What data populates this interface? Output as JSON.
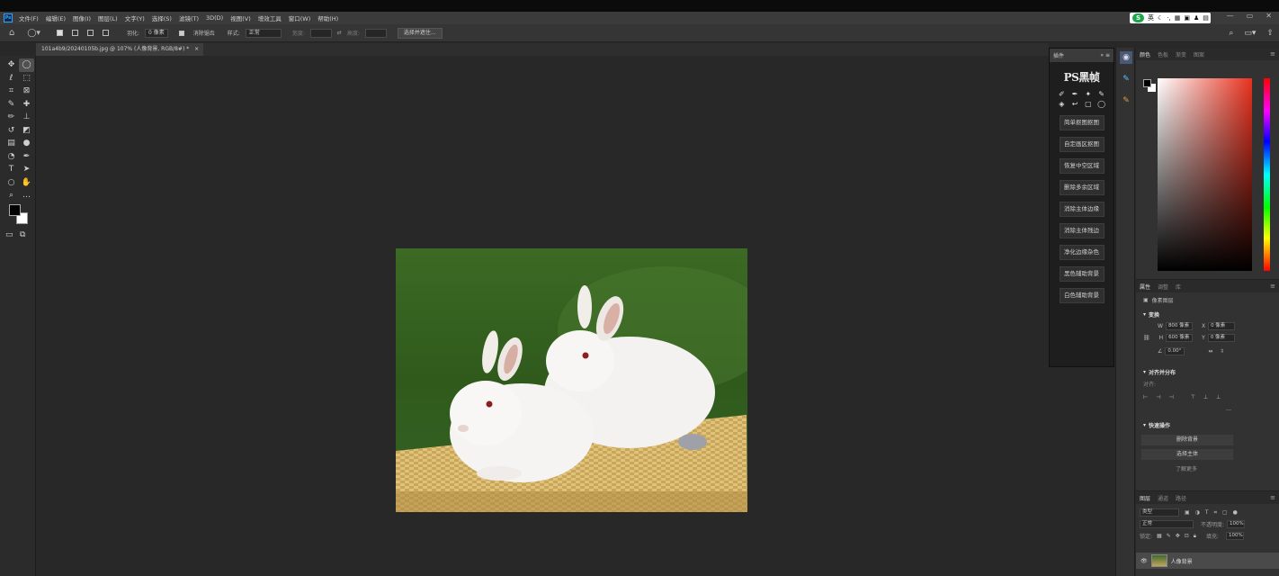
{
  "menu": {
    "logo": "Ps",
    "items": [
      "文件(F)",
      "编辑(E)",
      "图像(I)",
      "图层(L)",
      "文字(Y)",
      "选择(S)",
      "滤镜(T)",
      "3D(D)",
      "视图(V)",
      "增效工具",
      "窗口(W)",
      "帮助(H)"
    ]
  },
  "ime": {
    "brand": "S",
    "label": "英"
  },
  "window_controls": [
    "—",
    "▭",
    "✕"
  ],
  "options": {
    "feather_label": "羽化:",
    "feather_value": "0 像素",
    "antialias_label": "消除锯齿",
    "style_label": "样式:",
    "style_value": "正常",
    "width_label": "宽度:",
    "height_label": "高度:",
    "select_mask_button": "选择并遮住..."
  },
  "document_tab": {
    "title": "101a4b9/20240105b.jpg @ 107% (人像背景, RGB/8#) *",
    "close": "×"
  },
  "plugin": {
    "header_label": "插件",
    "logo": "PS黑帧",
    "buttons": [
      "简单抠图抠图",
      "自定画区抠图",
      "恢复中空区域",
      "删除多余区域",
      "消除主体边缘",
      "消除主体残边",
      "净化边缘杂色",
      "黑色辅助背景",
      "白色辅助背景"
    ]
  },
  "color_panel": {
    "tabs": [
      "颜色",
      "色板",
      "渐变",
      "图案"
    ]
  },
  "properties": {
    "tabs": [
      "属性",
      "调整",
      "库"
    ],
    "layer_type": "像素图层",
    "transform_label": "变换",
    "w_label": "W",
    "w_value": "800 像素",
    "h_label": "H",
    "h_value": "600 像素",
    "x_label": "X",
    "x_value": "0 像素",
    "y_label": "Y",
    "y_value": "0 像素",
    "angle_value": "0.00°",
    "align_label": "对齐并分布",
    "align_sub": "对齐:",
    "quick_label": "快速操作",
    "remove_bg_button": "删除背景",
    "select_subject_button": "选择主体",
    "learn_more": "了解更多"
  },
  "layers": {
    "tabs": [
      "图层",
      "通道",
      "路径"
    ],
    "filter_value": "类型",
    "blend_mode": "正常",
    "opacity_label": "不透明度:",
    "opacity_value": "100%",
    "lock_label": "锁定:",
    "fill_label": "填充:",
    "fill_value": "100%",
    "layer_name": "人像背景"
  }
}
